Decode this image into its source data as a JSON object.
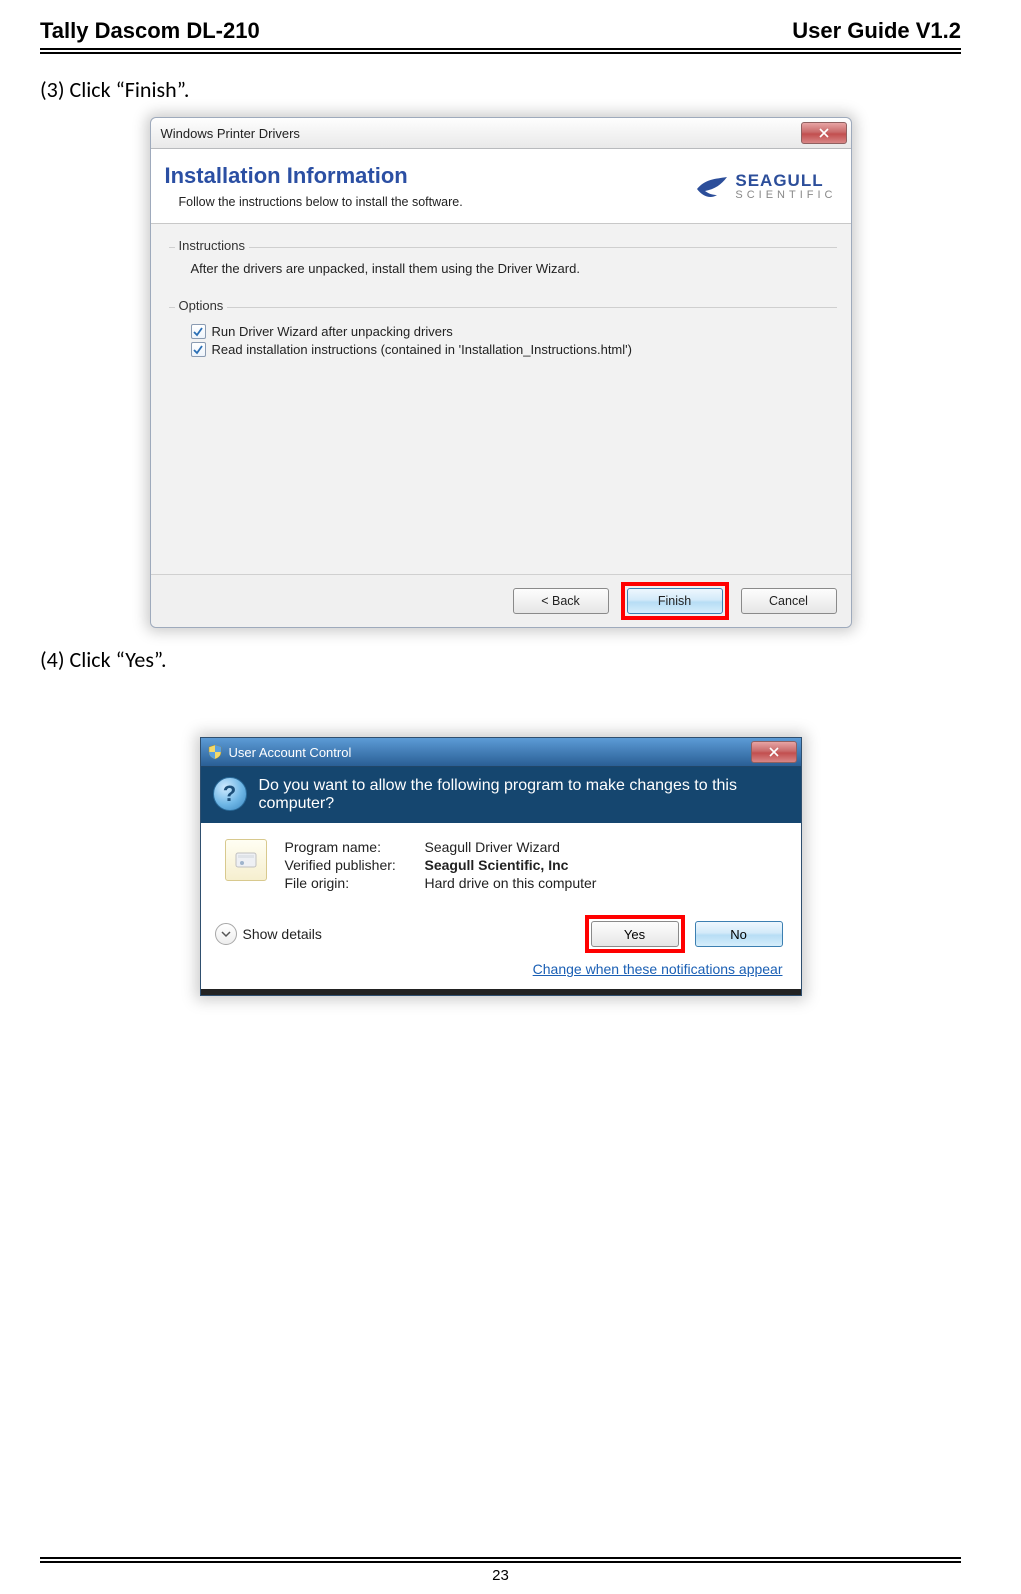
{
  "header": {
    "left": "Tally Dascom DL-210",
    "right": "User Guide V1.2"
  },
  "step3": "(3) Click “Finish”.",
  "dlg1": {
    "title": "Windows Printer Drivers",
    "banner_title": "Installation Information",
    "banner_sub": "Follow the instructions below to install the software.",
    "logo1": "SEAGULL",
    "logo2": "SCIENTIFIC",
    "group_instructions": "Instructions",
    "instructions_text": "After the drivers are unpacked, install them using the Driver Wizard.",
    "group_options": "Options",
    "opt1": "Run Driver Wizard after unpacking drivers",
    "opt2": "Read installation instructions (contained in 'Installation_Instructions.html')",
    "back": "< Back",
    "finish": "Finish",
    "cancel": "Cancel"
  },
  "step4": "(4) Click “Yes”.",
  "dlg2": {
    "title": "User Account Control",
    "question": "Do you want to allow the following program to make changes to this computer?",
    "k1": "Program name:",
    "v1": "Seagull Driver Wizard",
    "k2": "Verified publisher:",
    "v2": "Seagull Scientific, Inc",
    "k3": "File origin:",
    "v3": "Hard drive on this computer",
    "showdetails": "Show details",
    "yes": "Yes",
    "no": "No",
    "link": "Change when these notifications appear"
  },
  "pagenum": "23"
}
